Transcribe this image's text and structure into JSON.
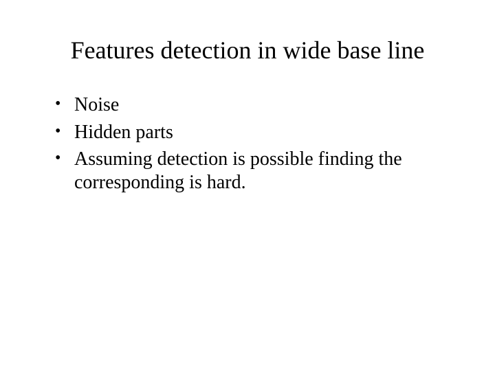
{
  "slide": {
    "title": "Features detection in wide base line",
    "bullets": [
      "Noise",
      "Hidden parts",
      "Assuming detection is possible finding the corresponding is hard."
    ]
  }
}
